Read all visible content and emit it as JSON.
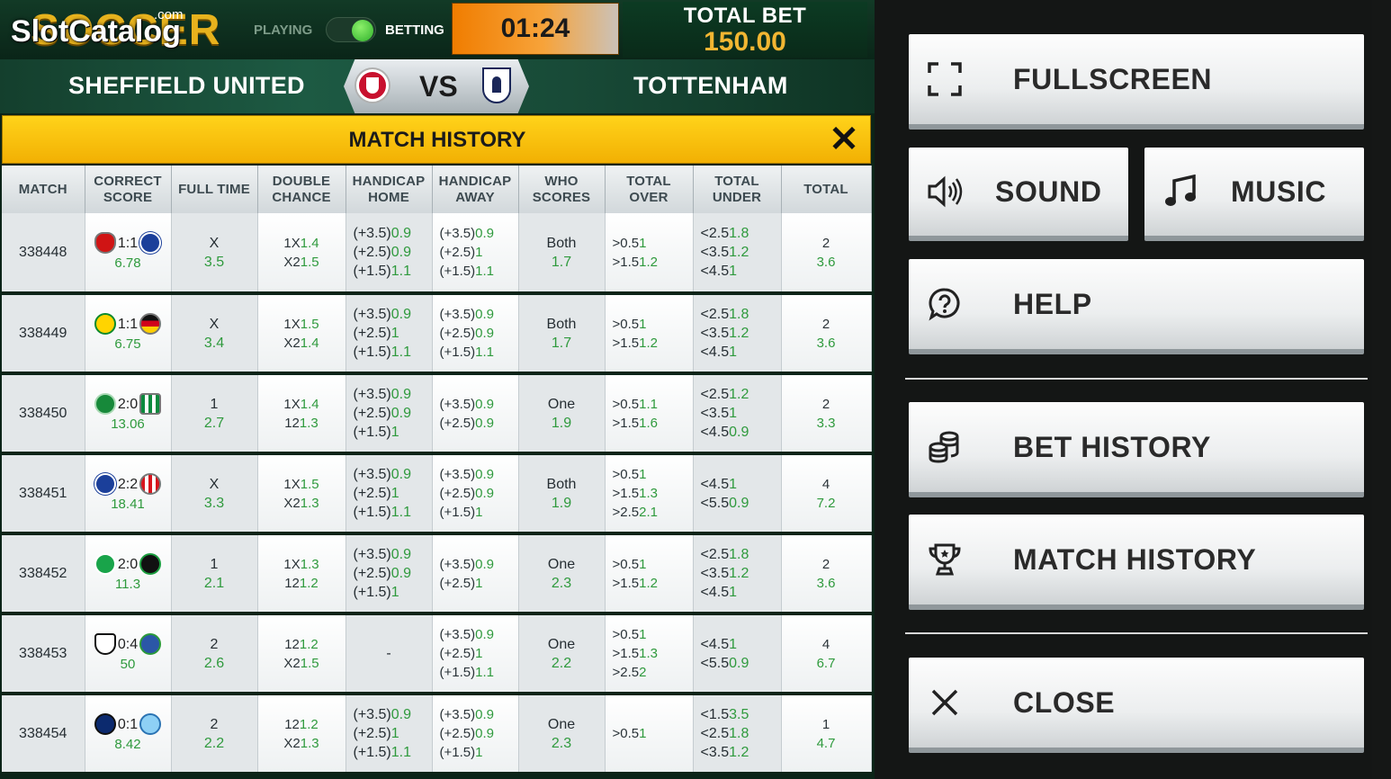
{
  "logo": {
    "brand": "SOCCER",
    "watermark": "SlotCatalog",
    "watermark_suffix": ".com"
  },
  "mode": {
    "playing_label": "PLAYING",
    "betting_label": "BETTING",
    "active": "BETTING"
  },
  "timer": "01:24",
  "total_bet": {
    "label": "TOTAL BET",
    "value": "150.00"
  },
  "match": {
    "home": "SHEFFIELD UNITED",
    "vs": "VS",
    "away": "TOTTENHAM"
  },
  "match_history": {
    "title": "MATCH HISTORY",
    "close_icon": "x-icon",
    "columns": [
      [
        "MATCH"
      ],
      [
        "CORRECT",
        "SCORE"
      ],
      [
        "FULL TIME"
      ],
      [
        "DOUBLE",
        "CHANCE"
      ],
      [
        "HANDICAP",
        "HOME"
      ],
      [
        "HANDICAP",
        "AWAY"
      ],
      [
        "WHO",
        "SCORES"
      ],
      [
        "TOTAL",
        "OVER"
      ],
      [
        "TOTAL",
        "UNDER"
      ],
      [
        "TOTAL"
      ]
    ],
    "rows": [
      {
        "match": "338448",
        "home_badge": "b-red",
        "away_badge": "b-blue",
        "score": "1:1",
        "score_odd": "6.78",
        "full_time": [
          "X",
          "3.5"
        ],
        "double_chance": [
          [
            "1X",
            "1.4"
          ],
          [
            "X2",
            "1.5"
          ]
        ],
        "hcp_home": [
          [
            "(+3.5)",
            "0.9"
          ],
          [
            "(+2.5)",
            "0.9"
          ],
          [
            "(+1.5)",
            "1.1"
          ]
        ],
        "hcp_away": [
          [
            "(+3.5)",
            "0.9"
          ],
          [
            "(+2.5)",
            "1"
          ],
          [
            "(+1.5)",
            "1.1"
          ]
        ],
        "who_scores": [
          "Both",
          "1.7"
        ],
        "total_over": [
          [
            ">0.5",
            "1"
          ],
          [
            ">1.5",
            "1.2"
          ]
        ],
        "total_under": [
          [
            "<2.5",
            "1.8"
          ],
          [
            "<3.5",
            "1.2"
          ],
          [
            "<4.5",
            "1"
          ]
        ],
        "total": [
          "2",
          "3.6"
        ]
      },
      {
        "match": "338449",
        "home_badge": "b-br",
        "away_badge": "b-de",
        "score": "1:1",
        "score_odd": "6.75",
        "full_time": [
          "X",
          "3.4"
        ],
        "double_chance": [
          [
            "1X",
            "1.5"
          ],
          [
            "X2",
            "1.4"
          ]
        ],
        "hcp_home": [
          [
            "(+3.5)",
            "0.9"
          ],
          [
            "(+2.5)",
            "1"
          ],
          [
            "(+1.5)",
            "1.1"
          ]
        ],
        "hcp_away": [
          [
            "(+3.5)",
            "0.9"
          ],
          [
            "(+2.5)",
            "0.9"
          ],
          [
            "(+1.5)",
            "1.1"
          ]
        ],
        "who_scores": [
          "Both",
          "1.7"
        ],
        "total_over": [
          [
            ">0.5",
            "1"
          ],
          [
            ">1.5",
            "1.2"
          ]
        ],
        "total_under": [
          [
            "<2.5",
            "1.8"
          ],
          [
            "<3.5",
            "1.2"
          ],
          [
            "<4.5",
            "1"
          ]
        ],
        "total": [
          "2",
          "3.6"
        ]
      },
      {
        "match": "338450",
        "home_badge": "b-celtic",
        "away_badge": "b-betis",
        "score": "2:0",
        "score_odd": "13.06",
        "full_time": [
          "1",
          "2.7"
        ],
        "double_chance": [
          [
            "1X",
            "1.4"
          ],
          [
            "12",
            "1.3"
          ]
        ],
        "hcp_home": [
          [
            "(+3.5)",
            "0.9"
          ],
          [
            "(+2.5)",
            "0.9"
          ],
          [
            "(+1.5)",
            "1"
          ]
        ],
        "hcp_away": [
          [
            "(+3.5)",
            "0.9"
          ],
          [
            "(+2.5)",
            "0.9"
          ]
        ],
        "who_scores": [
          "One",
          "1.9"
        ],
        "total_over": [
          [
            ">0.5",
            "1.1"
          ],
          [
            ">1.5",
            "1.6"
          ]
        ],
        "total_under": [
          [
            "<2.5",
            "1.2"
          ],
          [
            "<3.5",
            "1"
          ],
          [
            "<4.5",
            "0.9"
          ]
        ],
        "total": [
          "2",
          "3.3"
        ]
      },
      {
        "match": "338451",
        "home_badge": "b-blue",
        "away_badge": "b-sun",
        "score": "2:2",
        "score_odd": "18.41",
        "full_time": [
          "X",
          "3.3"
        ],
        "double_chance": [
          [
            "1X",
            "1.5"
          ],
          [
            "X2",
            "1.3"
          ]
        ],
        "hcp_home": [
          [
            "(+3.5)",
            "0.9"
          ],
          [
            "(+2.5)",
            "1"
          ],
          [
            "(+1.5)",
            "1.1"
          ]
        ],
        "hcp_away": [
          [
            "(+3.5)",
            "0.9"
          ],
          [
            "(+2.5)",
            "0.9"
          ],
          [
            "(+1.5)",
            "1"
          ]
        ],
        "who_scores": [
          "Both",
          "1.9"
        ],
        "total_over": [
          [
            ">0.5",
            "1"
          ],
          [
            ">1.5",
            "1.3"
          ],
          [
            ">2.5",
            "2.1"
          ]
        ],
        "total_under": [
          [
            "<4.5",
            "1"
          ],
          [
            "<5.5",
            "0.9"
          ]
        ],
        "total": [
          "4",
          "7.2"
        ]
      },
      {
        "match": "338452",
        "home_badge": "b-werder",
        "away_badge": "b-96",
        "score": "2:0",
        "score_odd": "11.3",
        "full_time": [
          "1",
          "2.1"
        ],
        "double_chance": [
          [
            "1X",
            "1.3"
          ],
          [
            "12",
            "1.2"
          ]
        ],
        "hcp_home": [
          [
            "(+3.5)",
            "0.9"
          ],
          [
            "(+2.5)",
            "0.9"
          ],
          [
            "(+1.5)",
            "1"
          ]
        ],
        "hcp_away": [
          [
            "(+3.5)",
            "0.9"
          ],
          [
            "(+2.5)",
            "1"
          ]
        ],
        "who_scores": [
          "One",
          "2.3"
        ],
        "total_over": [
          [
            ">0.5",
            "1"
          ],
          [
            ">1.5",
            "1.2"
          ]
        ],
        "total_under": [
          [
            "<2.5",
            "1.8"
          ],
          [
            "<3.5",
            "1.2"
          ],
          [
            "<4.5",
            "1"
          ]
        ],
        "total": [
          "2",
          "3.6"
        ]
      },
      {
        "match": "338453",
        "home_badge": "b-fulham",
        "away_badge": "b-black",
        "score": "0:4",
        "score_odd": "50",
        "full_time": [
          "2",
          "2.6"
        ],
        "double_chance": [
          [
            "12",
            "1.2"
          ],
          [
            "X2",
            "1.5"
          ]
        ],
        "hcp_home": [
          [
            "-",
            ""
          ]
        ],
        "hcp_away": [
          [
            "(+3.5)",
            "0.9"
          ],
          [
            "(+2.5)",
            "1"
          ],
          [
            "(+1.5)",
            "1.1"
          ]
        ],
        "who_scores": [
          "One",
          "2.2"
        ],
        "total_over": [
          [
            ">0.5",
            "1"
          ],
          [
            ">1.5",
            "1.3"
          ],
          [
            ">2.5",
            "2"
          ]
        ],
        "total_under": [
          [
            "<4.5",
            "1"
          ],
          [
            "<5.5",
            "0.9"
          ]
        ],
        "total": [
          "4",
          "6.7"
        ]
      },
      {
        "match": "338454",
        "home_badge": "b-inter",
        "away_badge": "b-lazio",
        "score": "0:1",
        "score_odd": "8.42",
        "full_time": [
          "2",
          "2.2"
        ],
        "double_chance": [
          [
            "12",
            "1.2"
          ],
          [
            "X2",
            "1.3"
          ]
        ],
        "hcp_home": [
          [
            "(+3.5)",
            "0.9"
          ],
          [
            "(+2.5)",
            "1"
          ],
          [
            "(+1.5)",
            "1.1"
          ]
        ],
        "hcp_away": [
          [
            "(+3.5)",
            "0.9"
          ],
          [
            "(+2.5)",
            "0.9"
          ],
          [
            "(+1.5)",
            "1"
          ]
        ],
        "who_scores": [
          "One",
          "2.3"
        ],
        "total_over": [
          [
            ">0.5",
            "1"
          ]
        ],
        "total_under": [
          [
            "<1.5",
            "3.5"
          ],
          [
            "<2.5",
            "1.8"
          ],
          [
            "<3.5",
            "1.2"
          ]
        ],
        "total": [
          "1",
          "4.7"
        ]
      }
    ]
  },
  "menu": {
    "fullscreen": "FULLSCREEN",
    "sound": "SOUND",
    "music": "MUSIC",
    "help": "HELP",
    "bet_history": "BET HISTORY",
    "match_history": "MATCH HISTORY",
    "close": "CLOSE"
  },
  "colors": {
    "accent_yellow": "#f2b003",
    "odds_green": "#2f9a3d",
    "total_bet_gold": "#f2b632",
    "timer_orange": "#f07d00"
  }
}
